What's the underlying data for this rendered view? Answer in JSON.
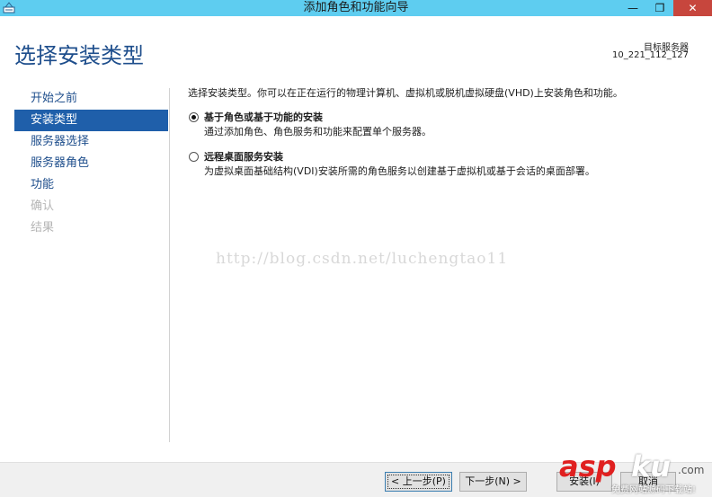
{
  "window": {
    "title": "添加角色和功能向导",
    "minimize_glyph": "—",
    "maximize_glyph": "❐",
    "close_glyph": "✕"
  },
  "header": {
    "page_title": "选择安装类型",
    "target_server_label": "目标服务器",
    "target_server_name": "10_221_112_127"
  },
  "nav": {
    "items": [
      {
        "label": "开始之前",
        "state": "normal"
      },
      {
        "label": "安装类型",
        "state": "active"
      },
      {
        "label": "服务器选择",
        "state": "normal"
      },
      {
        "label": "服务器角色",
        "state": "normal"
      },
      {
        "label": "功能",
        "state": "normal"
      },
      {
        "label": "确认",
        "state": "disabled"
      },
      {
        "label": "结果",
        "state": "disabled"
      }
    ]
  },
  "content": {
    "intro": "选择安装类型。你可以在正在运行的物理计算机、虚拟机或脱机虚拟硬盘(VHD)上安装角色和功能。",
    "options": [
      {
        "title": "基于角色或基于功能的安装",
        "description": "通过添加角色、角色服务和功能来配置单个服务器。",
        "selected": true
      },
      {
        "title": "远程桌面服务安装",
        "description": "为虚拟桌面基础结构(VDI)安装所需的角色服务以创建基于虚拟机或基于会话的桌面部署。",
        "selected": false
      }
    ]
  },
  "watermark": "http://blog.csdn.net/luchengtao11",
  "footer": {
    "prev_label": "< 上一步(P)",
    "next_label": "下一步(N) >",
    "install_label": "安装(I)",
    "cancel_label": "取消"
  },
  "logo": {
    "asp": "asp",
    "ku": "ku",
    "com": ".com",
    "slogan": "免费网站源码下载站!"
  },
  "colors": {
    "titlebar": "#5ecdf0",
    "accent": "#1f5faa",
    "close": "#c7463d",
    "title_text": "#1e4e8c"
  }
}
